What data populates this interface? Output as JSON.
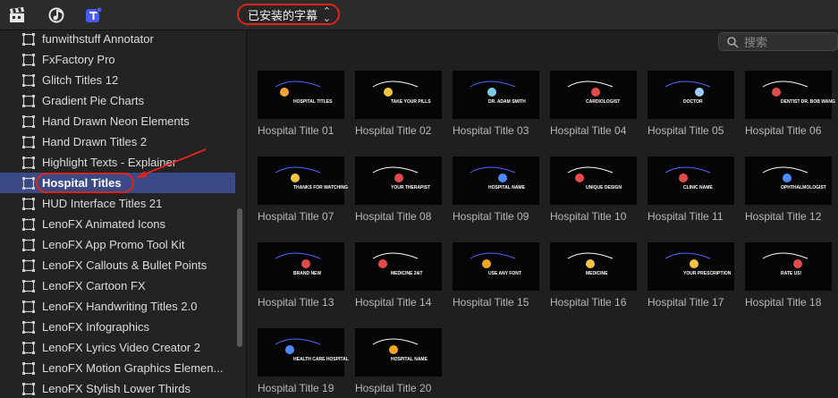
{
  "toolbar": {
    "icons": [
      "clapper-icon",
      "music-icon",
      "titles-icon"
    ],
    "category_dropdown": "已安装的字幕",
    "search_placeholder": "搜索"
  },
  "sidebar": {
    "items": [
      {
        "label": "funwithstuff Annotator",
        "selected": false
      },
      {
        "label": "FxFactory Pro",
        "selected": false
      },
      {
        "label": "Glitch Titles 12",
        "selected": false
      },
      {
        "label": "Gradient Pie Charts",
        "selected": false
      },
      {
        "label": "Hand Drawn Neon Elements",
        "selected": false
      },
      {
        "label": "Hand Drawn Titles 2",
        "selected": false
      },
      {
        "label": "Highlight Texts - Explainer",
        "selected": false
      },
      {
        "label": "Hospital Titles",
        "selected": true
      },
      {
        "label": "HUD Interface Titles 21",
        "selected": false
      },
      {
        "label": "LenoFX Animated Icons",
        "selected": false
      },
      {
        "label": "LenoFX App Promo Tool Kit",
        "selected": false
      },
      {
        "label": "LenoFX Callouts & Bullet Points",
        "selected": false
      },
      {
        "label": "LenoFX Cartoon FX",
        "selected": false
      },
      {
        "label": "LenoFX Handwriting Titles 2.0",
        "selected": false
      },
      {
        "label": "LenoFX Infographics",
        "selected": false
      },
      {
        "label": "LenoFX Lyrics Video Creator 2",
        "selected": false
      },
      {
        "label": "LenoFX Motion Graphics Elemen...",
        "selected": false
      },
      {
        "label": "LenoFX Stylish Lower Thirds",
        "selected": false
      }
    ]
  },
  "browser": {
    "titles": [
      {
        "label": "Hospital Title 01",
        "text": "HOSPITAL TITLES"
      },
      {
        "label": "Hospital Title 02",
        "text": "TAKE YOUR PILLS"
      },
      {
        "label": "Hospital Title 03",
        "text": "DR. ADAM SMITH"
      },
      {
        "label": "Hospital Title 04",
        "text": "CARDIOLOGIST"
      },
      {
        "label": "Hospital Title 05",
        "text": "DOCTOR"
      },
      {
        "label": "Hospital Title 06",
        "text": "DENTIST DR. BOB WANG"
      },
      {
        "label": "Hospital Title 07",
        "text": "THANKS FOR WATCHING"
      },
      {
        "label": "Hospital Title 08",
        "text": "YOUR THERAPIST"
      },
      {
        "label": "Hospital Title 09",
        "text": "HOSPITAL NAME"
      },
      {
        "label": "Hospital Title 10",
        "text": "UNIQUE DESIGN"
      },
      {
        "label": "Hospital Title 11",
        "text": "CLINIC NAME"
      },
      {
        "label": "Hospital Title 12",
        "text": "OPHTHALMOLOGIST"
      },
      {
        "label": "Hospital Title 13",
        "text": "BRAND NEW"
      },
      {
        "label": "Hospital Title 14",
        "text": "MEDICINE 24/7"
      },
      {
        "label": "Hospital Title 15",
        "text": "USE ANY FONT"
      },
      {
        "label": "Hospital Title 16",
        "text": "MEDICINE"
      },
      {
        "label": "Hospital Title 17",
        "text": "YOUR PRESCRIPTION"
      },
      {
        "label": "Hospital Title 18",
        "text": "RATE US!"
      },
      {
        "label": "Hospital Title 19",
        "text": "HEALTH CARE HOSPITAL"
      },
      {
        "label": "Hospital Title 20",
        "text": "HOSPITAL NAME"
      }
    ]
  },
  "colors": {
    "accent_red": "#e0241c",
    "selection": "#3a4a86",
    "titles_icon_blue": "#4a5cf0"
  }
}
